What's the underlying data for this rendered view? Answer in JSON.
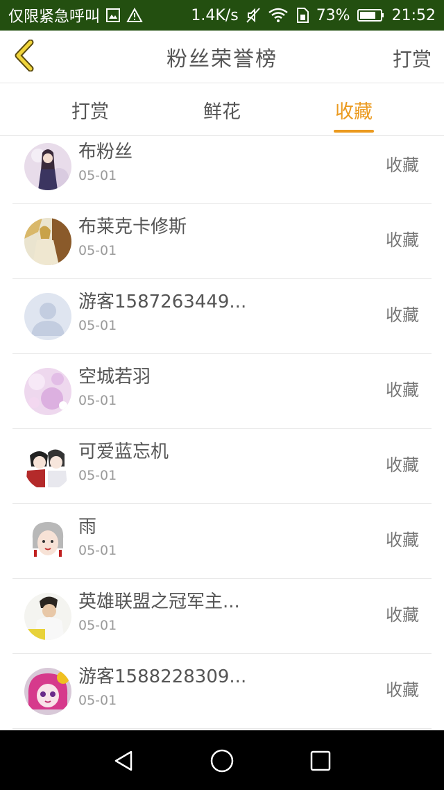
{
  "status_bar": {
    "carrier": "仅限紧急呼叫",
    "speed": "1.4K/s",
    "battery": "73%",
    "time": "21:52",
    "icons": [
      "image-icon",
      "warning-icon",
      "mute-icon",
      "wifi-icon",
      "sim-icon",
      "battery-icon"
    ]
  },
  "header": {
    "title": "粉丝荣誉榜",
    "action_label": "打赏",
    "back_icon": "chevron-left-icon"
  },
  "tabs": [
    {
      "label": "打赏",
      "active": false
    },
    {
      "label": "鲜花",
      "active": false
    },
    {
      "label": "收藏",
      "active": true
    }
  ],
  "accent_color": "#eb9a1f",
  "list": [
    {
      "name": "布粉丝",
      "date": "05-01",
      "action": "收藏",
      "avatar": "anime-girl-purple"
    },
    {
      "name": "布莱克卡修斯",
      "date": "05-01",
      "action": "收藏",
      "avatar": "anime-girl-gold"
    },
    {
      "name": "游客1587263449...",
      "date": "05-01",
      "action": "收藏",
      "avatar": "default-person"
    },
    {
      "name": "空城若羽",
      "date": "05-01",
      "action": "收藏",
      "avatar": "pink-bokeh"
    },
    {
      "name": "可爱蓝忘机",
      "date": "05-01",
      "action": "收藏",
      "avatar": "chibi-couple"
    },
    {
      "name": "雨",
      "date": "05-01",
      "action": "收藏",
      "avatar": "cartoon-girl-gray-hair"
    },
    {
      "name": "英雄联盟之冠军主...",
      "date": "05-01",
      "action": "收藏",
      "avatar": "young-man-photo"
    },
    {
      "name": "游客1588228309...",
      "date": "05-01",
      "action": "收藏",
      "avatar": "pink-hair-doll"
    }
  ],
  "nav_bar": {
    "icons": [
      "back-triangle-icon",
      "home-circle-icon",
      "recents-square-icon"
    ]
  }
}
